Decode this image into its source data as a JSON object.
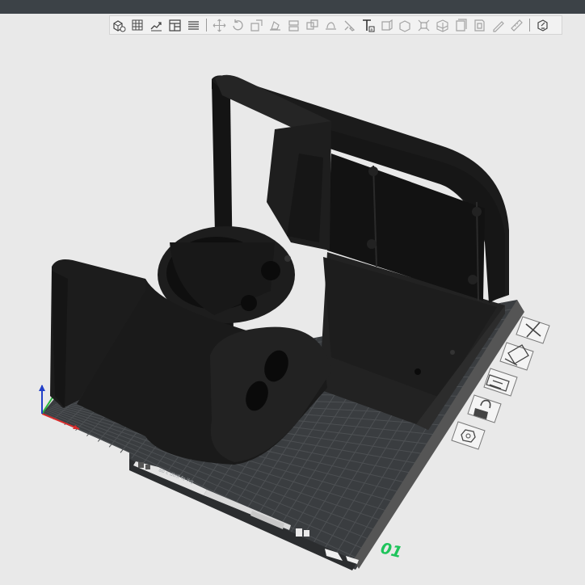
{
  "window": {
    "title_bar_color": "#3c4247"
  },
  "toolbar": {
    "groups": [
      [
        "add-box-icon",
        "add-grid-icon",
        "auto-arrange-icon",
        "plate-layout-icon",
        "list-icon"
      ],
      [
        "move-icon",
        "rotate-icon",
        "scale-icon",
        "place-on-face-icon",
        "cut-icon",
        "boolean-icon",
        "paint-support-icon",
        "paint-seam-icon",
        "text-icon",
        "measure-icon",
        "assembly-icon",
        "split-icon",
        "mesh-icon",
        "slice-layers-icon",
        "variable-layer-icon",
        "brim-icon",
        "ruler-icon"
      ],
      [
        "help-icon"
      ]
    ]
  },
  "plate": {
    "number": "01",
    "label_strip_text": "ab c dtrif fo ikg",
    "name_field_text": "",
    "grid_color": "#4a4d50",
    "bed_color": "#3a3d40",
    "accent_color": "#1ec45b"
  },
  "plate_side_buttons": [
    {
      "name": "close-plate-button",
      "icon": "close-icon"
    },
    {
      "name": "plate-view-button",
      "icon": "orient-icon"
    },
    {
      "name": "arrange-button",
      "icon": "arrange-icon"
    },
    {
      "name": "lock-button",
      "icon": "lock-open-icon"
    },
    {
      "name": "plate-settings-button",
      "icon": "hexagon-nut-icon"
    }
  ],
  "axes": {
    "x_color": "#d92b2b",
    "y_color": "#27b53b",
    "z_color": "#2340c8"
  }
}
